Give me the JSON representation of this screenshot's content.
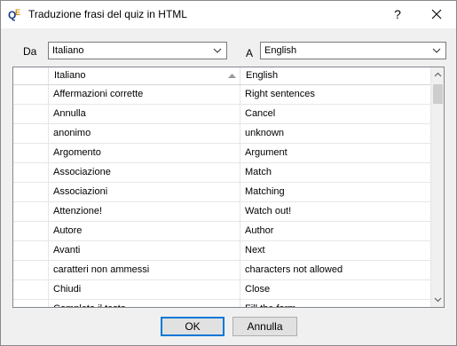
{
  "window": {
    "title": "Traduzione frasi del quiz in HTML",
    "help_glyph": "?",
    "app_icon_text": "QE"
  },
  "source_lang": {
    "label": "Da",
    "value": "Italiano"
  },
  "target_lang": {
    "label": "A",
    "value": "English"
  },
  "grid": {
    "columns": [
      "Italiano",
      "English"
    ],
    "sorted_column": "Italiano",
    "rows": [
      {
        "it": "Affermazioni corrette",
        "en": "Right sentences"
      },
      {
        "it": "Annulla",
        "en": "Cancel"
      },
      {
        "it": "anonimo",
        "en": "unknown"
      },
      {
        "it": "Argomento",
        "en": "Argument"
      },
      {
        "it": "Associazione",
        "en": "Match"
      },
      {
        "it": "Associazioni",
        "en": "Matching"
      },
      {
        "it": "Attenzione!",
        "en": "Watch out!"
      },
      {
        "it": "Autore",
        "en": "Author"
      },
      {
        "it": "Avanti",
        "en": "Next"
      },
      {
        "it": "caratteri non ammessi",
        "en": "characters not allowed"
      },
      {
        "it": "Chiudi",
        "en": "Close"
      },
      {
        "it": "Completa il testo",
        "en": "Fill the form"
      }
    ]
  },
  "buttons": {
    "ok": "OK",
    "cancel": "Annulla"
  },
  "icons": {
    "close": "close-icon",
    "help": "help-icon",
    "dropdown": "chevron-down-icon",
    "sort": "sort-ascending-icon",
    "scroll_up": "scroll-up-icon",
    "scroll_down": "scroll-down-icon"
  },
  "colors": {
    "focus_border": "#0078d7",
    "window_bg": "#f0f0f0",
    "title_bg": "#ffffff"
  }
}
